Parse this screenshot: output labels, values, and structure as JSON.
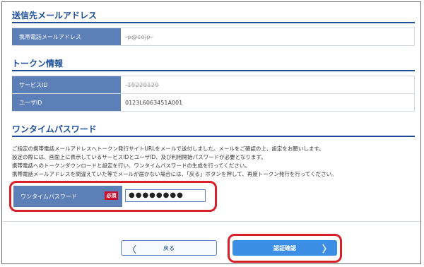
{
  "email_section": {
    "title": "送信先メールアドレス",
    "rows": [
      {
        "label": "携帯電話メールアドレス",
        "value": "-p@cojp-"
      }
    ]
  },
  "token_section": {
    "title": "トークン情報",
    "rows": [
      {
        "label": "サービスID",
        "value": "-19220129"
      },
      {
        "label": "ユーザID",
        "value": "0123L6063451A001"
      }
    ]
  },
  "otp_section": {
    "title": "ワンタイムパスワード",
    "notice": [
      "ご指定の携帯電話メールアドレスへトークン発行サイトURLをメールで送付しました。メールをご確認の上、設定をお願いします。",
      "設定の際には、画面上に表示しているサービスIDとユーザID、及び利用開始パスワードが必要となります。",
      "携帯電話へのトークンダウンロードと設定を行い、ワンタイムパスワードの生成を行ってください。",
      "携帯電話メールアドレスを間違えていた等でメールが届かない場合には、「戻る」ボタンを押して、再度トークン発行を行ってください。"
    ],
    "field_label": "ワンタイムパスワード",
    "required_badge": "必須",
    "field_value": "●●●●●●●●"
  },
  "buttons": {
    "back": "戻る",
    "back_arrow": "〈",
    "confirm": "認証確認",
    "confirm_arrow": "〉"
  },
  "colors": {
    "accent": "#1d4e9a",
    "label_bg": "#5c7fb7",
    "confirm_bg": "#3b8ee4",
    "highlight": "#d7202a"
  }
}
